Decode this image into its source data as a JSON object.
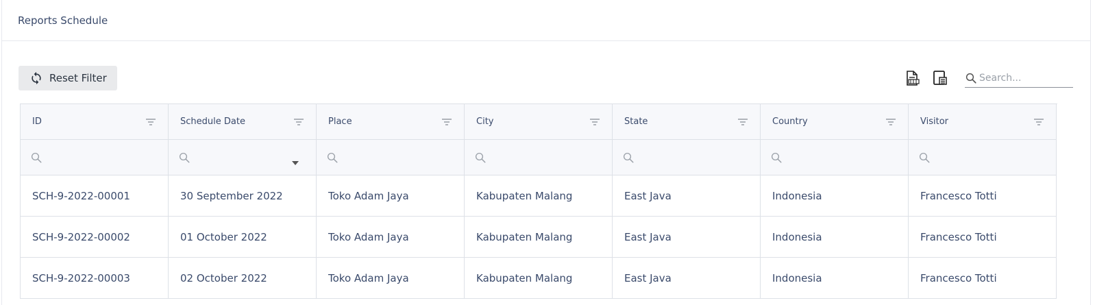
{
  "header": {
    "title": "Reports Schedule"
  },
  "toolbar": {
    "reset_label": "Reset Filter",
    "reset_icon": "refresh-icon",
    "export_icon": "xls-export-icon",
    "print_icon": "print-icon",
    "search_placeholder": "Search..."
  },
  "grid": {
    "columns": [
      "ID",
      "Schedule Date",
      "Place",
      "City",
      "State",
      "Country",
      "Visitor"
    ],
    "rows": [
      [
        "SCH-9-2022-00001",
        "30 September 2022",
        "Toko Adam Jaya",
        "Kabupaten Malang",
        "East Java",
        "Indonesia",
        "Francesco Totti"
      ],
      [
        "SCH-9-2022-00002",
        "01 October 2022",
        "Toko Adam Jaya",
        "Kabupaten Malang",
        "East Java",
        "Indonesia",
        "Francesco Totti"
      ],
      [
        "SCH-9-2022-00003",
        "02 October 2022",
        "Toko Adam Jaya",
        "Kabupaten Malang",
        "East Java",
        "Indonesia",
        "Francesco Totti"
      ]
    ]
  }
}
